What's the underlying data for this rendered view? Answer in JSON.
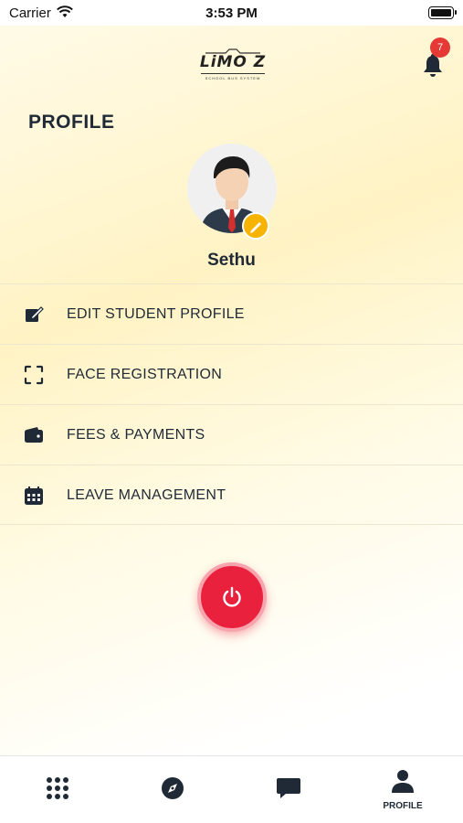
{
  "status_bar": {
    "carrier": "Carrier",
    "time": "3:53 PM"
  },
  "header": {
    "logo_text": "LiMO Z",
    "logo_tagline": "SCHOOL BUS SYSTEM",
    "notification_count": "7"
  },
  "page": {
    "title": "PROFILE"
  },
  "profile": {
    "name": "Sethu"
  },
  "menu": {
    "items": [
      {
        "label": "EDIT STUDENT PROFILE",
        "icon": "edit-icon"
      },
      {
        "label": "FACE REGISTRATION",
        "icon": "face-scan-icon"
      },
      {
        "label": "FEES & PAYMENTS",
        "icon": "wallet-icon"
      },
      {
        "label": "LEAVE MANAGEMENT",
        "icon": "calendar-icon"
      }
    ]
  },
  "logout": {
    "icon": "power-icon"
  },
  "tab_bar": {
    "tabs": [
      {
        "icon": "grid-icon",
        "label": ""
      },
      {
        "icon": "compass-icon",
        "label": ""
      },
      {
        "icon": "chat-icon",
        "label": ""
      },
      {
        "icon": "person-icon",
        "label": "PROFILE",
        "active": true
      }
    ]
  },
  "colors": {
    "accent_red": "#e9213d",
    "edit_badge": "#f6b400",
    "text_dark": "#1f2a36",
    "badge_red": "#e53935"
  }
}
